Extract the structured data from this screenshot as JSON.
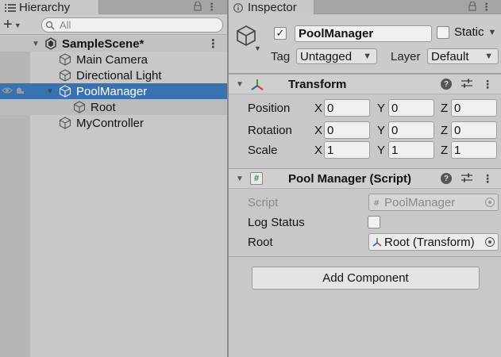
{
  "hierarchy": {
    "tab_label": "Hierarchy",
    "search_placeholder": "All",
    "scene_name": "SampleScene*",
    "items": [
      {
        "label": "Main Camera"
      },
      {
        "label": "Directional Light"
      },
      {
        "label": "PoolManager"
      },
      {
        "label": "Root"
      },
      {
        "label": "MyController"
      }
    ]
  },
  "inspector": {
    "tab_label": "Inspector",
    "object_name": "PoolManager",
    "static_label": "Static",
    "tag_label": "Tag",
    "tag_value": "Untagged",
    "layer_label": "Layer",
    "layer_value": "Default",
    "transform": {
      "title": "Transform",
      "rows": [
        {
          "label": "Position",
          "x": "0",
          "y": "0",
          "z": "0"
        },
        {
          "label": "Rotation",
          "x": "0",
          "y": "0",
          "z": "0"
        },
        {
          "label": "Scale",
          "x": "1",
          "y": "1",
          "z": "1"
        }
      ],
      "axis_x": "X",
      "axis_y": "Y",
      "axis_z": "Z"
    },
    "script_component": {
      "title": "Pool Manager (Script)",
      "script_label": "Script",
      "script_value": "PoolManager",
      "log_status_label": "Log Status",
      "root_label": "Root",
      "root_value": "Root (Transform)"
    },
    "add_component_label": "Add Component"
  },
  "colors": {
    "selection": "#3a72b0",
    "panel_bg": "#c8c8c8"
  }
}
